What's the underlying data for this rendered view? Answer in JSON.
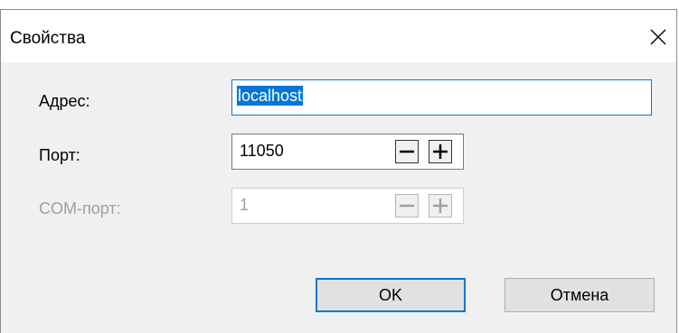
{
  "window": {
    "title": "Свойства"
  },
  "address": {
    "label": "Адрес:",
    "value": "localhost"
  },
  "port": {
    "label": "Порт:",
    "value": "11050"
  },
  "com_port": {
    "label": "COM-порт:",
    "value": "1"
  },
  "buttons": {
    "ok_label": "OK",
    "cancel_label": "Отмена"
  },
  "icons": {
    "close": "close-icon",
    "minus": "minus-icon",
    "plus": "plus-icon"
  },
  "colors": {
    "accent": "#0078d7",
    "dialog_bg": "#f0f0f0",
    "disabled_text": "#a0a0a0"
  }
}
